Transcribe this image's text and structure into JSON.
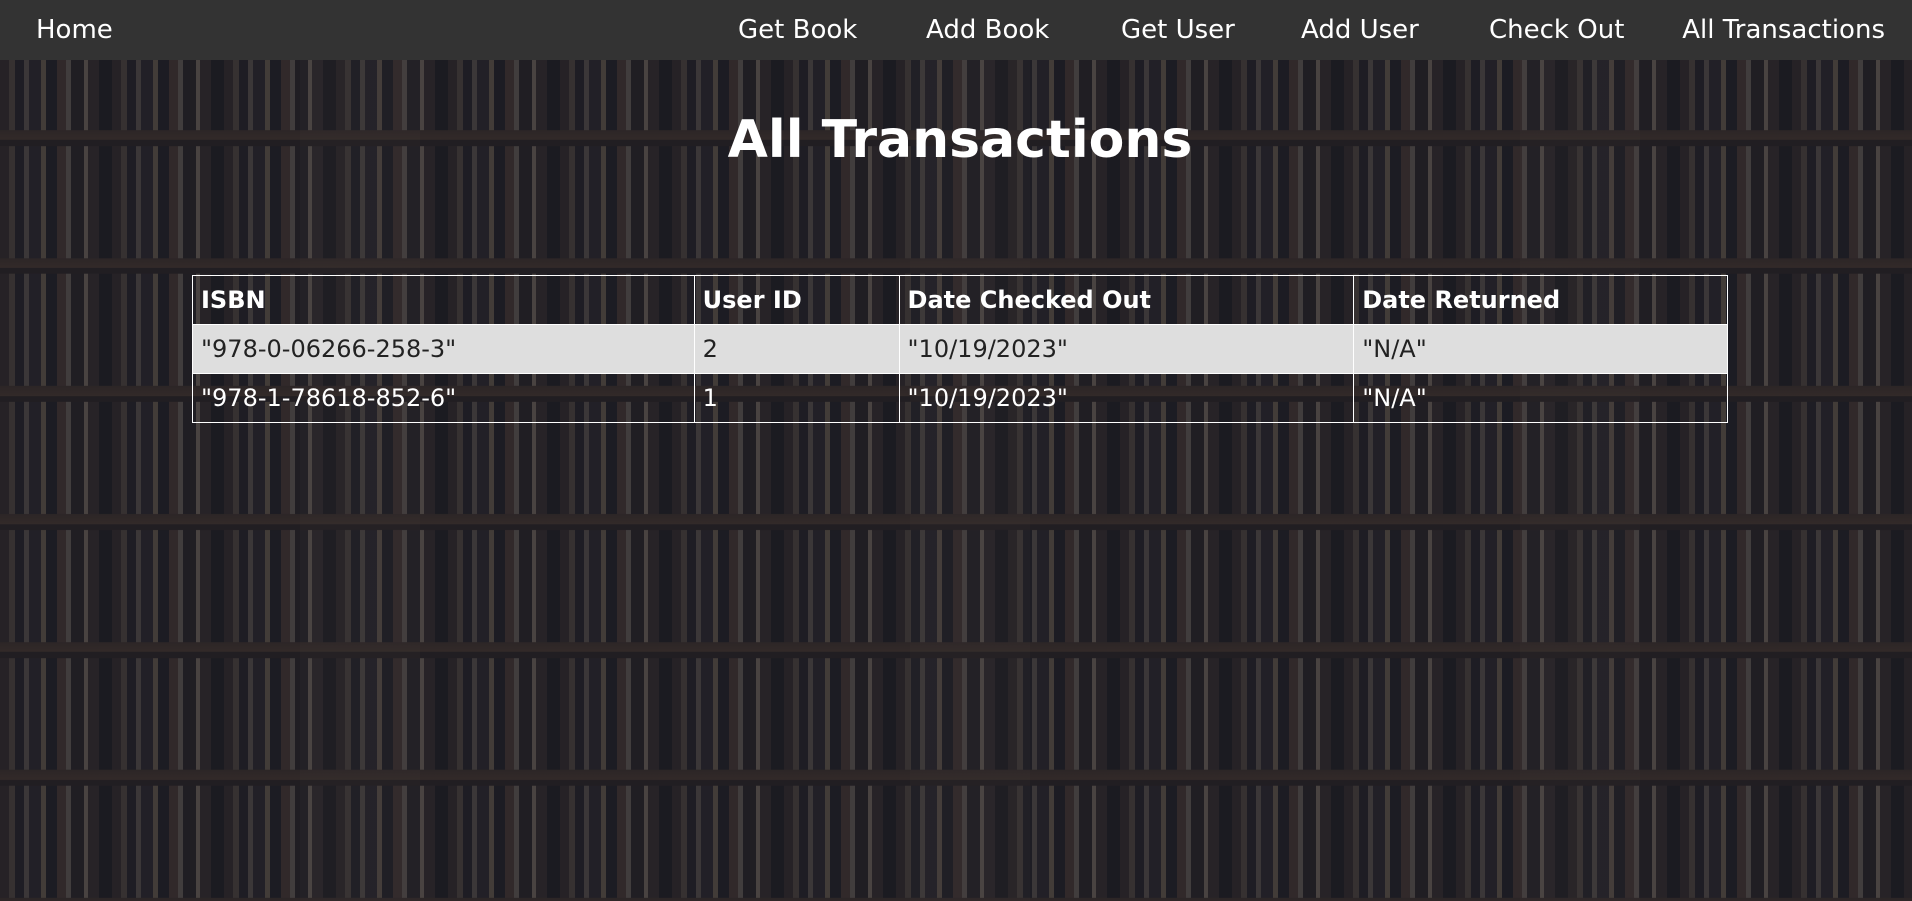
{
  "nav": {
    "home": "Home",
    "get_book": "Get Book",
    "add_book": "Add Book",
    "get_user": "Get User",
    "add_user": "Add User",
    "check_out": "Check Out",
    "all_transactions": "All Transactions"
  },
  "page": {
    "title": "All Transactions"
  },
  "table": {
    "headers": [
      "ISBN",
      "User ID",
      "Date Checked Out",
      "Date Returned"
    ],
    "rows": [
      [
        "\"978-0-06266-258-3\"",
        "2",
        "\"10/19/2023\"",
        "\"N/A\""
      ],
      [
        "\"978-1-78618-852-6\"",
        "1",
        "\"10/19/2023\"",
        "\"N/A\""
      ]
    ]
  },
  "colors": {
    "navbar_bg": "#333333",
    "text": "#ffffff",
    "odd_row_bg": "#dedede"
  }
}
